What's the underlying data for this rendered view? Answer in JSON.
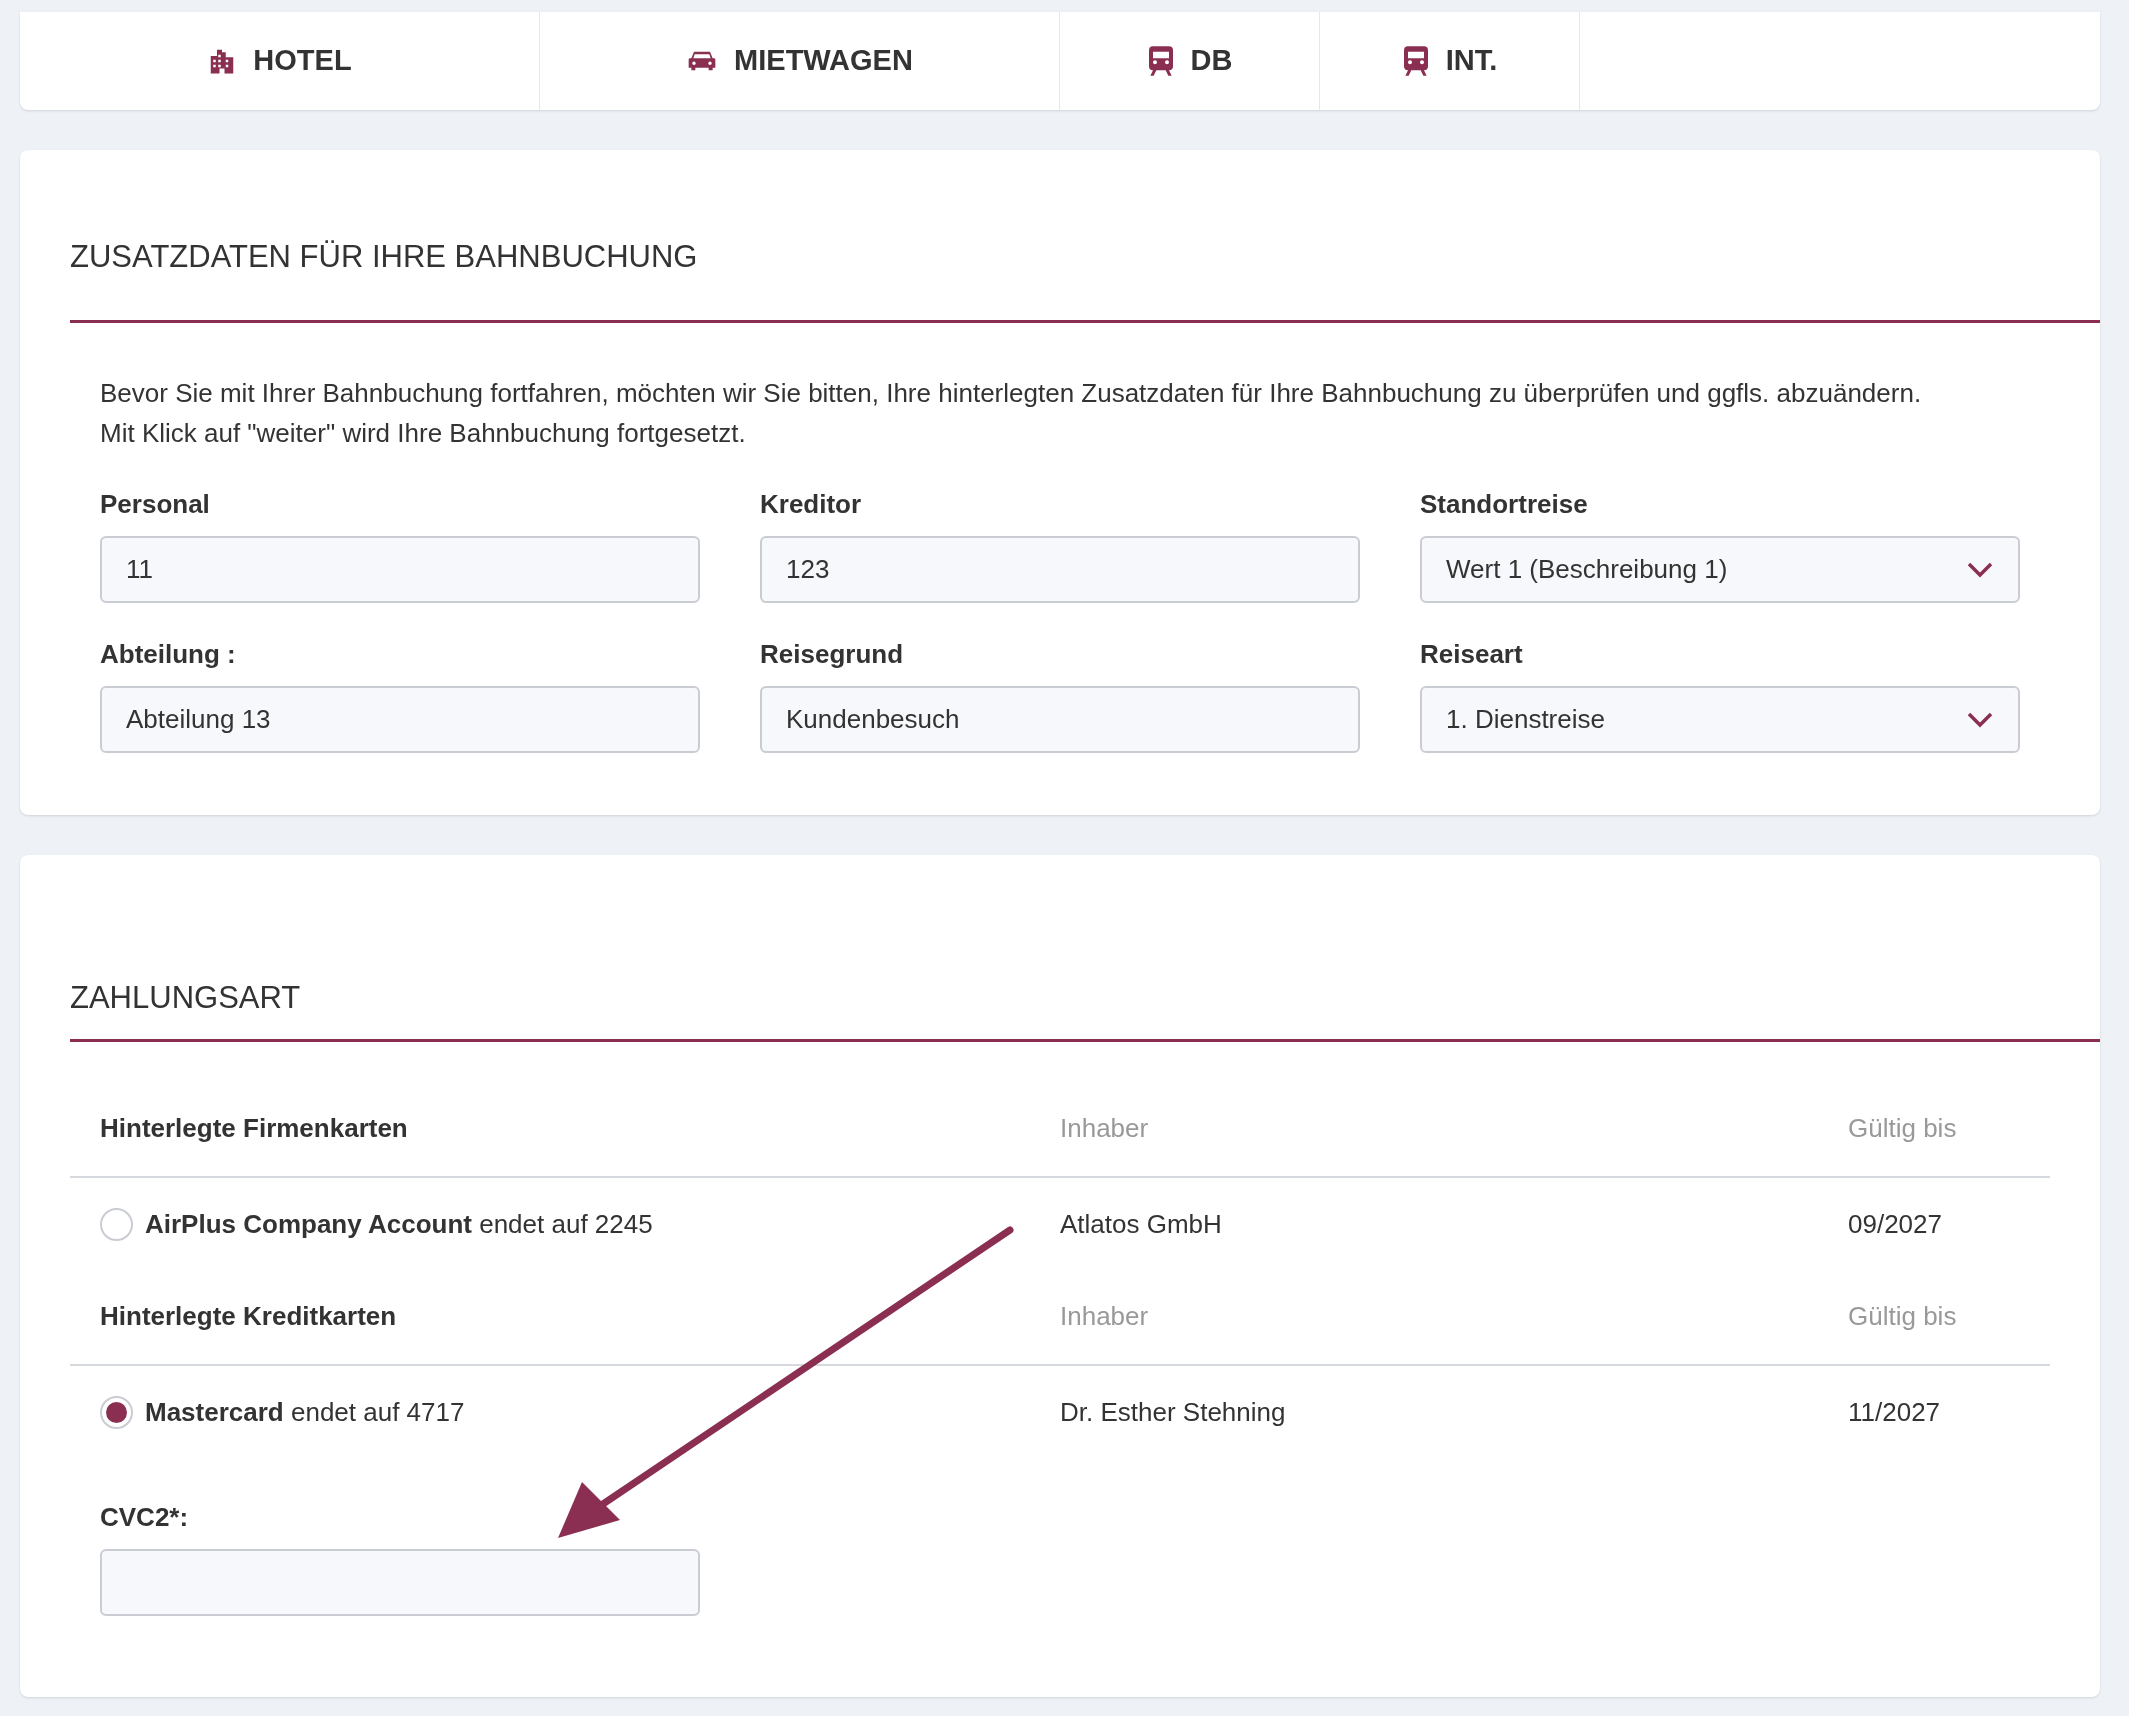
{
  "tabs": [
    {
      "label": "HOTEL",
      "kind": "building"
    },
    {
      "label": "MIETWAGEN",
      "kind": "car"
    },
    {
      "label": "DB",
      "kind": "train"
    },
    {
      "label": "INT.",
      "kind": "train"
    }
  ],
  "additional_data": {
    "title": "ZUSATZDATEN FÜR IHRE BAHNBUCHUNG",
    "intro": [
      "Bevor Sie mit Ihrer Bahnbuchung fortfahren, möchten wir Sie bitten, Ihre hinterlegten Zusatzdaten für Ihre Bahnbuchung zu überprüfen und ggfls. abzuändern.",
      "Mit Klick auf \"weiter\" wird Ihre Bahnbuchung fortgesetzt."
    ],
    "fields": [
      {
        "label": "Personal",
        "value": "11",
        "kind": "text"
      },
      {
        "label": "Kreditor",
        "value": "123",
        "kind": "text"
      },
      {
        "label": "Standortreise",
        "value": "Wert 1 (Beschreibung 1)",
        "kind": "select"
      },
      {
        "label": "Abteilung :",
        "value": "Abteilung 13",
        "kind": "text"
      },
      {
        "label": "Reisegrund",
        "value": "Kundenbesuch",
        "kind": "text"
      },
      {
        "label": "Reiseart",
        "value": "1. Dienstreise",
        "kind": "select"
      }
    ]
  },
  "payment": {
    "title": "ZAHLUNGSART",
    "sections": [
      {
        "heading": "Hinterlegte Firmenkarten",
        "owner_column": "Inhaber",
        "valid_column": "Gültig bis",
        "cards": [
          {
            "name": "AirPlus Company Account",
            "suffix": "endet auf 2245",
            "owner": "Atlatos GmbH",
            "valid": "09/2027",
            "selected": false
          }
        ]
      },
      {
        "heading": "Hinterlegte Kreditkarten",
        "owner_column": "Inhaber",
        "valid_column": "Gültig bis",
        "cards": [
          {
            "name": "Mastercard",
            "suffix": "endet auf 4717",
            "owner": "Dr. Esther Stehning",
            "valid": "11/2027",
            "selected": true
          }
        ]
      }
    ],
    "cvc": {
      "label": "CVC2*:"
    }
  }
}
